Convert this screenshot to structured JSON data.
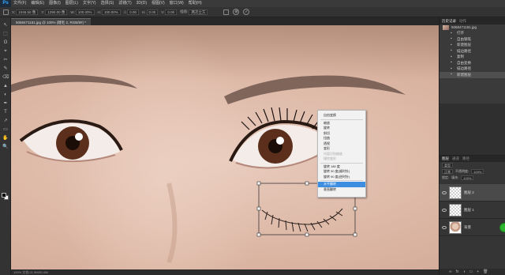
{
  "app": {
    "logo": "Ps",
    "menus": [
      "文件(F)",
      "编辑(E)",
      "图像(I)",
      "图层(L)",
      "文字(Y)",
      "选择(S)",
      "滤镜(T)",
      "3D(D)",
      "视图(V)",
      "窗口(W)",
      "帮助(H)"
    ]
  },
  "options": {
    "x_label": "X:",
    "x_value": "1046.50 像",
    "y_label": "Y:",
    "y_value": "1290.00 像",
    "w_label": "W:",
    "w_value": "100.00%",
    "h_label": "H:",
    "h_value": "100.00%",
    "angle_label": "△",
    "angle_value": "0.00",
    "hskew_label": "H:",
    "hskew_value": "0.00",
    "vskew_label": "V:",
    "vskew_value": "0.00",
    "interp_label": "插值:",
    "interp_value": "两次立方",
    "cancel_glyph": "⊘",
    "commit_glyph": "✓"
  },
  "document": {
    "tab_title": "5068471181.jpg @ 100% (睫毛 2, RGB/8#) *"
  },
  "status": {
    "text": "100%    文档:21.9M/51.6M"
  },
  "context_menu": {
    "items": [
      {
        "label": "自由变换",
        "state": "normal"
      },
      {
        "sep": true
      },
      {
        "label": "缩放",
        "state": "normal"
      },
      {
        "label": "旋转",
        "state": "normal"
      },
      {
        "label": "斜切",
        "state": "normal"
      },
      {
        "label": "扭曲",
        "state": "normal"
      },
      {
        "label": "透视",
        "state": "normal"
      },
      {
        "label": "变形",
        "state": "normal"
      },
      {
        "label": "内容识别缩放",
        "state": "disabled"
      },
      {
        "label": "操控变形",
        "state": "disabled"
      },
      {
        "sep": true
      },
      {
        "label": "旋转 180 度",
        "state": "normal"
      },
      {
        "label": "旋转 90 度(顺时针)",
        "state": "normal"
      },
      {
        "label": "旋转 90 度(逆时针)",
        "state": "normal"
      },
      {
        "sep": true
      },
      {
        "label": "水平翻转",
        "state": "highlight"
      },
      {
        "label": "垂直翻转",
        "state": "normal"
      }
    ]
  },
  "history_panel": {
    "tabs": [
      "历史记录",
      "动作"
    ],
    "snapshot": "5068471181.jpg",
    "items": [
      "打开",
      "自由钢笔",
      "新建图层",
      "描边路径",
      "复制",
      "自由变换",
      "描边路径",
      "新建图层"
    ]
  },
  "layers_panel": {
    "tabs": [
      "图层",
      "通道",
      "路径"
    ],
    "kind_label": "类型",
    "blend_mode": "正常",
    "opacity_label": "不透明度:",
    "opacity_value": "100%",
    "lock_label": "锁定:",
    "fill_label": "填充:",
    "fill_value": "100%",
    "layers": [
      {
        "name": "图层 2",
        "selected": true
      },
      {
        "name": "图层 1",
        "selected": false
      },
      {
        "name": "背景",
        "selected": false
      }
    ],
    "footer_icons": [
      "∞",
      "fx",
      "◑",
      "▭",
      "+",
      "🗑"
    ]
  },
  "tools": [
    "↖",
    "⬚",
    "ʘ",
    "⌖",
    "✂",
    "✎",
    "⌫",
    "▲",
    "◐",
    "✒",
    "T",
    "↗",
    "▭",
    "✋",
    "🔍"
  ],
  "colors": {
    "accent": "#3d8ee0",
    "panel_bg": "#2f2f2f",
    "menubar_bg": "#3a3a3a"
  }
}
